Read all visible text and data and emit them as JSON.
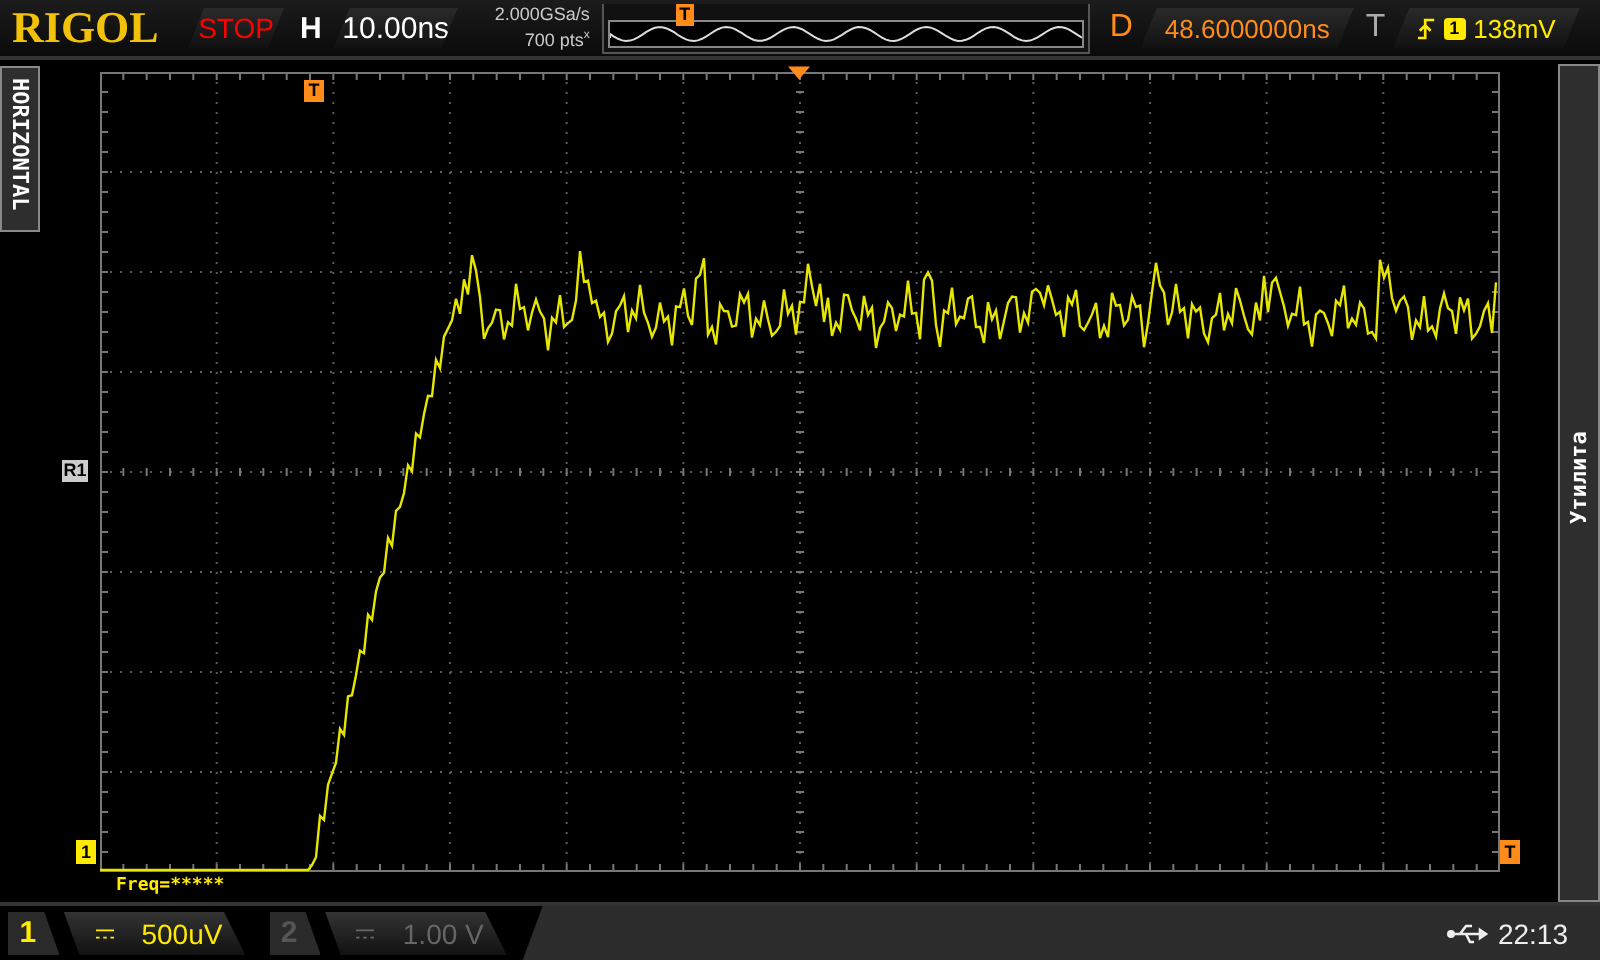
{
  "brand": "RIGOL",
  "run_state": "STOP",
  "horizontal": {
    "label": "H",
    "timebase": "10.00ns",
    "sample_rate": "2.000GSa/s",
    "memory_depth": "700 pts$^{x}$",
    "overview_trigger_mark": "T",
    "trigger_position_mark": "T"
  },
  "delay": {
    "label": "D",
    "value": "48.6000000ns"
  },
  "trigger": {
    "label": "T",
    "source": "1",
    "level": "138mV"
  },
  "side_tabs": {
    "left": "HORIZONTAL",
    "right": "Утилита"
  },
  "markers": {
    "reference": "R1",
    "channel_ground": "1",
    "trigger_level": "T"
  },
  "measurement": "Freq=*****",
  "channels": [
    {
      "number": "1",
      "scale": "500uV",
      "enabled": true
    },
    {
      "number": "2",
      "scale": "1.00 V",
      "enabled": false
    }
  ],
  "clock": "22:13"
}
